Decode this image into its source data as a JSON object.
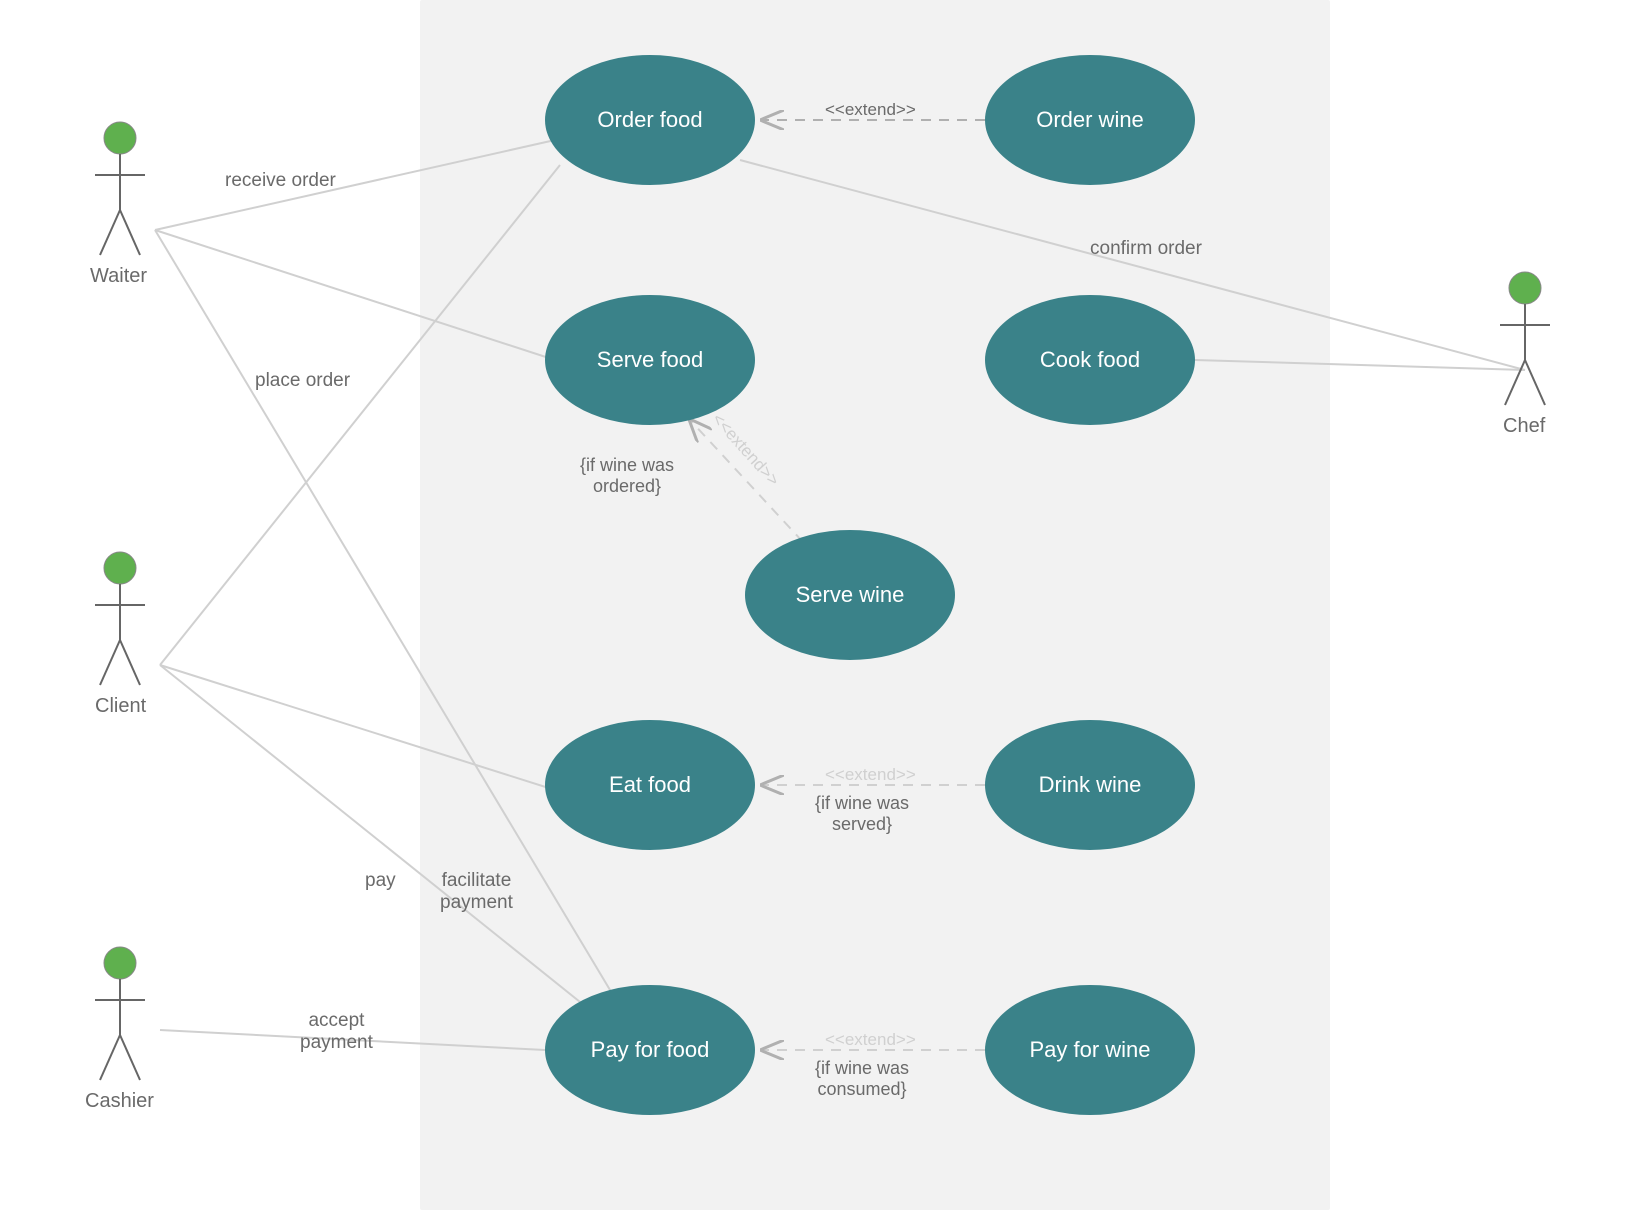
{
  "actors": {
    "waiter": "Waiter",
    "client": "Client",
    "cashier": "Cashier",
    "chef": "Chef"
  },
  "usecases": {
    "orderFood": "Order food",
    "orderWine": "Order wine",
    "serveFood": "Serve food",
    "cookFood": "Cook food",
    "serveWine": "Serve wine",
    "eatFood": "Eat food",
    "drinkWine": "Drink wine",
    "payForFood": "Pay for food",
    "payForWine": "Pay for wine"
  },
  "associations": {
    "receiveOrder": "receive order",
    "placeOrder": "place order",
    "confirmOrder": "confirm order",
    "pay": "pay",
    "facilitatePayment": "facilitate\npayment",
    "acceptPayment": "accept\npayment"
  },
  "extends": {
    "extendLabel": "<<extend>>",
    "ifWineOrdered": "{if wine was\nordered}",
    "ifWineServed": "{if wine was\nserved}",
    "ifWineConsumed": "{if wine was\nconsumed}"
  }
}
